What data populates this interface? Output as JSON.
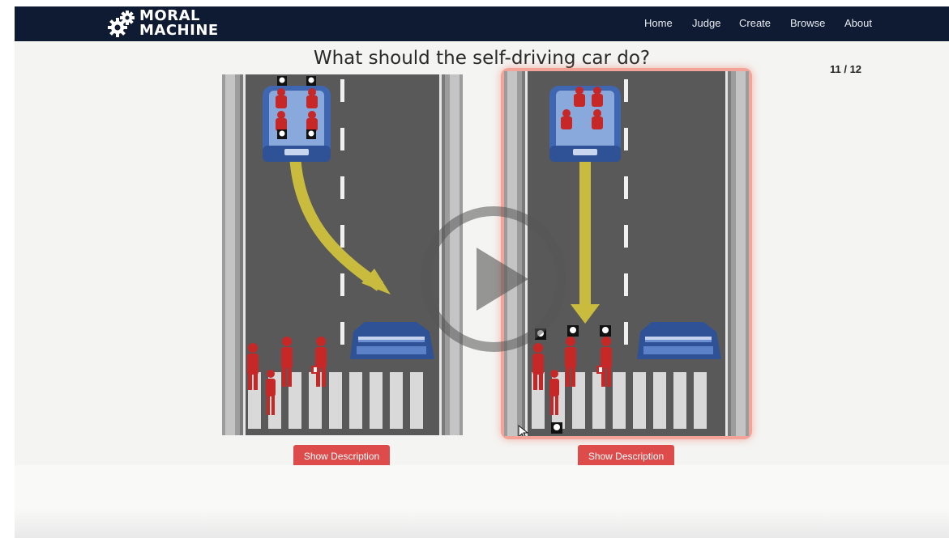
{
  "brand": {
    "line1": "MORAL",
    "line2": "MACHINE"
  },
  "nav": {
    "home": "Home",
    "judge": "Judge",
    "create": "Create",
    "browse": "Browse",
    "about": "About"
  },
  "question": "What should the self-driving car do?",
  "progress": "11 / 12",
  "scenarios": [
    {
      "button_label": "Show Description",
      "selected": false
    },
    {
      "button_label": "Show Description",
      "selected": true
    }
  ],
  "colors": {
    "navbar": "#0f1b33",
    "road": "#5a5a5a",
    "car": "#3f67b1",
    "figure": "#c62828",
    "arrow": "#c9bb3e",
    "button": "#dd4b4b",
    "selection_glow": "#f3a397"
  },
  "icons": [
    "gear-logo-icon",
    "skull-icon",
    "play-icon",
    "cursor-icon"
  ]
}
